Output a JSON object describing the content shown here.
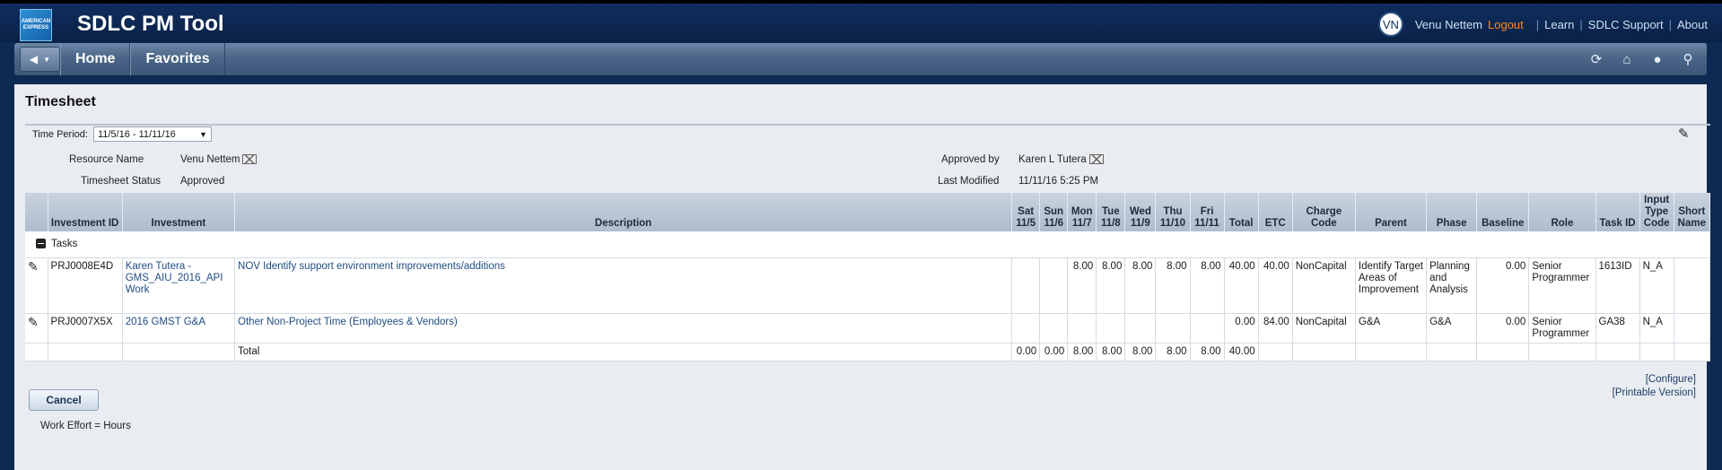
{
  "app": {
    "title": "SDLC PM Tool",
    "logo_text": "AMERICAN EXPRESS"
  },
  "user": {
    "initials": "VN",
    "name": "Venu Nettem",
    "logout": "Logout",
    "links": [
      "Learn",
      "SDLC Support",
      "About"
    ]
  },
  "nav": {
    "items": [
      "Home",
      "Favorites"
    ],
    "icons": [
      "refresh-icon",
      "home-icon",
      "help-icon",
      "search-icon"
    ]
  },
  "page": {
    "title": "Timesheet",
    "time_period_label": "Time Period:",
    "time_period_value": "11/5/16 - 11/11/16",
    "resource_name_label": "Resource Name",
    "resource_name_value": "Venu Nettem",
    "status_label": "Timesheet Status",
    "status_value": "Approved",
    "approved_by_label": "Approved by",
    "approved_by_value": "Karen L Tutera",
    "last_modified_label": "Last Modified",
    "last_modified_value": "11/11/16 5:25 PM"
  },
  "table": {
    "headers": {
      "inv_id": "Investment ID",
      "investment": "Investment",
      "description": "Description",
      "sat": "Sat 11/5",
      "sun": "Sun 11/6",
      "mon": "Mon 11/7",
      "tue": "Tue 11/8",
      "wed": "Wed 11/9",
      "thu": "Thu 11/10",
      "fri": "Fri 11/11",
      "total": "Total",
      "etc": "ETC",
      "charge": "Charge Code",
      "parent": "Parent",
      "phase": "Phase",
      "baseline": "Baseline",
      "role": "Role",
      "task_id": "Task ID",
      "input_type": "Input Type Code",
      "short_name": "Short Name"
    },
    "group_label": "Tasks",
    "rows": [
      {
        "inv_id": "PRJ0008E4D",
        "investment": "Karen Tutera - GMS_AIU_2016_API Work",
        "description": "NOV Identify support environment improvements/additions",
        "sat": "",
        "sun": "",
        "mon": "8.00",
        "tue": "8.00",
        "wed": "8.00",
        "thu": "8.00",
        "fri": "8.00",
        "total": "40.00",
        "etc": "40.00",
        "charge": "NonCapital",
        "parent": "Identify Target Areas of Improvement",
        "phase": "Planning and Analysis",
        "baseline": "0.00",
        "role": "Senior Programmer",
        "task_id": "1613ID",
        "input_type": "N_A",
        "short_name": ""
      },
      {
        "inv_id": "PRJ0007X5X",
        "investment": "2016 GMST G&A",
        "description": "Other Non-Project Time (Employees & Vendors)",
        "sat": "",
        "sun": "",
        "mon": "",
        "tue": "",
        "wed": "",
        "thu": "",
        "fri": "",
        "total": "0.00",
        "etc": "84.00",
        "charge": "NonCapital",
        "parent": "G&A",
        "phase": "G&A",
        "baseline": "0.00",
        "role": "Senior Programmer",
        "task_id": "GA38",
        "input_type": "N_A",
        "short_name": ""
      }
    ],
    "totals": {
      "label": "Total",
      "sat": "0.00",
      "sun": "0.00",
      "mon": "8.00",
      "tue": "8.00",
      "wed": "8.00",
      "thu": "8.00",
      "fri": "8.00",
      "total": "40.00"
    }
  },
  "actions": {
    "configure": "[Configure]",
    "printable": "[Printable Version]",
    "cancel": "Cancel",
    "effort_note": "Work Effort = Hours"
  }
}
